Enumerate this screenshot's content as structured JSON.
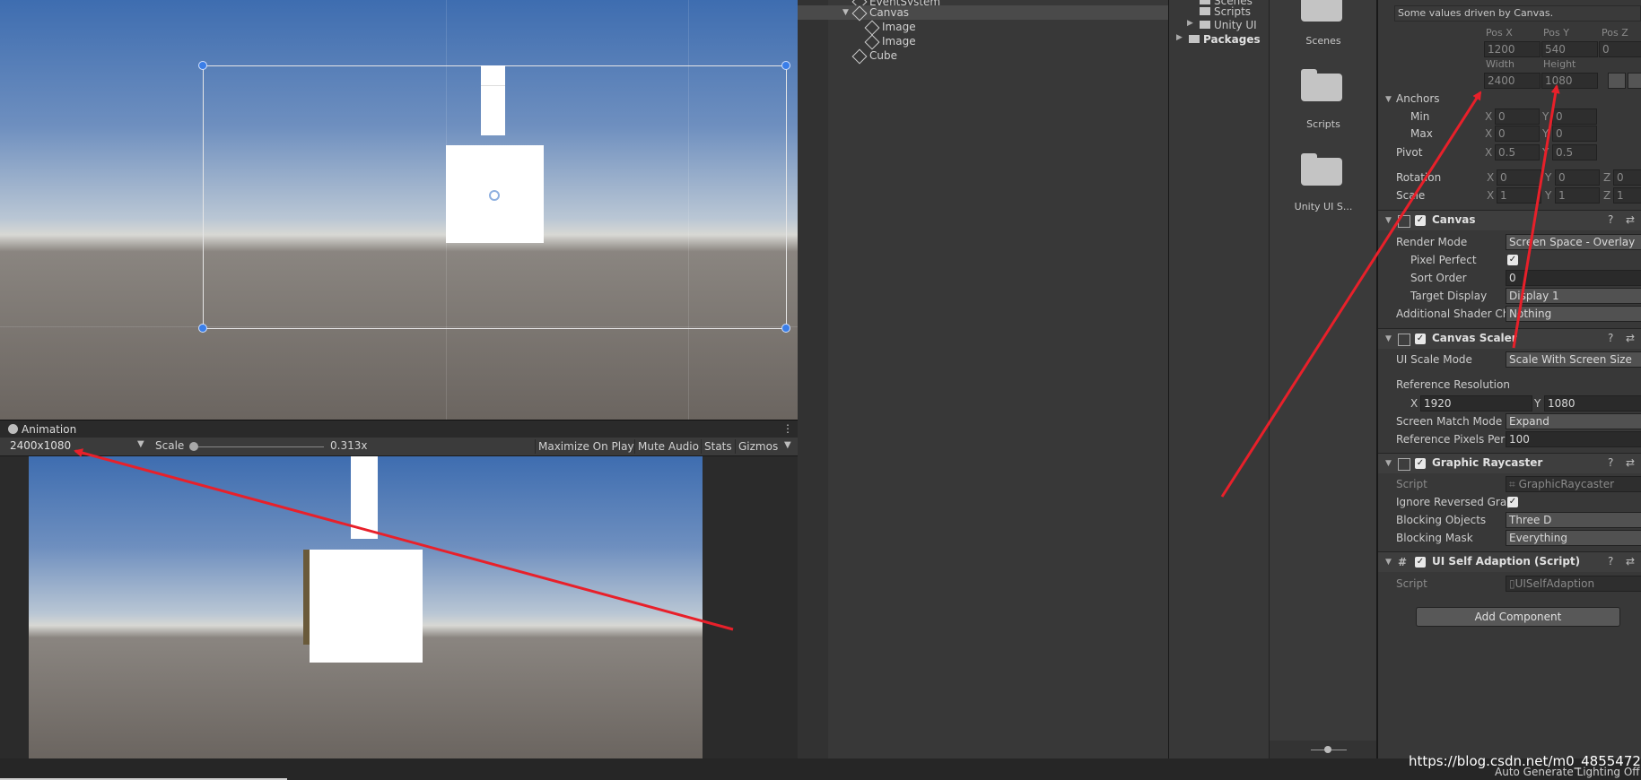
{
  "scene": {},
  "animation_tab": {
    "label": "Animation"
  },
  "game_toolbar": {
    "resolution": "2400x1080",
    "scale_label": "Scale",
    "scale_value": "0.313x",
    "maximize_on_play": "Maximize On Play",
    "mute_audio": "Mute Audio",
    "stats": "Stats",
    "gizmos": "Gizmos"
  },
  "hierarchy": {
    "items": [
      {
        "label": "EventSystem"
      },
      {
        "label": "Canvas"
      },
      {
        "label": "Image"
      },
      {
        "label": "Image"
      },
      {
        "label": "Cube"
      }
    ]
  },
  "project": {
    "tree": [
      {
        "label": "Scenes"
      },
      {
        "label": "Scripts"
      },
      {
        "label": "Unity UI Sa"
      },
      {
        "label": "Packages"
      }
    ],
    "folders": [
      {
        "label": "Scenes"
      },
      {
        "label": "Scripts"
      },
      {
        "label": "Unity UI S..."
      }
    ]
  },
  "inspector": {
    "driven_note": "Some values driven by Canvas.",
    "pos_x_label": "Pos X",
    "pos_y_label": "Pos Y",
    "pos_z_label": "Pos Z",
    "pos_x": "1200",
    "pos_y": "540",
    "pos_z": "0",
    "width_label": "Width",
    "height_label": "Height",
    "width": "2400",
    "height": "1080",
    "anchors_label": "Anchors",
    "min_label": "Min",
    "max_label": "Max",
    "x_label": "X",
    "y_label": "Y",
    "z_label": "Z",
    "min_x": "0",
    "min_y": "0",
    "max_x": "0",
    "max_y": "0",
    "pivot_label": "Pivot",
    "pivot_x": "0.5",
    "pivot_y": "0.5",
    "rotation_label": "Rotation",
    "rot_x": "0",
    "rot_y": "0",
    "rot_z": "0",
    "scale_label": "Scale",
    "scale_x": "1",
    "scale_y": "1",
    "scale_z": "1",
    "canvas": {
      "title": "Canvas",
      "render_mode_label": "Render Mode",
      "render_mode": "Screen Space - Overlay",
      "pixel_perfect_label": "Pixel Perfect",
      "sort_order_label": "Sort Order",
      "sort_order": "0",
      "target_display_label": "Target Display",
      "target_display": "Display 1",
      "additional_shader_label": "Additional Shader Ch",
      "additional_shader": "Nothing"
    },
    "canvas_scaler": {
      "title": "Canvas Scaler",
      "ui_scale_mode_label": "UI Scale Mode",
      "ui_scale_mode": "Scale With Screen Size",
      "reference_resolution_label": "Reference Resolution",
      "ref_x": "1920",
      "ref_y": "1080",
      "screen_match_mode_label": "Screen Match Mode",
      "screen_match_mode": "Expand",
      "ref_pixels_label": "Reference Pixels Per",
      "ref_pixels": "100"
    },
    "graphic_raycaster": {
      "title": "Graphic Raycaster",
      "script_label": "Script",
      "script": "GraphicRaycaster",
      "ignore_reversed_label": "Ignore Reversed Grap",
      "blocking_objects_label": "Blocking Objects",
      "blocking_objects": "Three D",
      "blocking_mask_label": "Blocking Mask",
      "blocking_mask": "Everything"
    },
    "ui_self_adaption": {
      "title": "UI Self Adaption (Script)",
      "script_label": "Script",
      "script": "UISelfAdaption"
    },
    "add_component": "Add Component"
  },
  "status": {
    "watermark": "https://blog.csdn.net/m0_48554728",
    "lighting": "Auto Generate Lighting Off"
  }
}
